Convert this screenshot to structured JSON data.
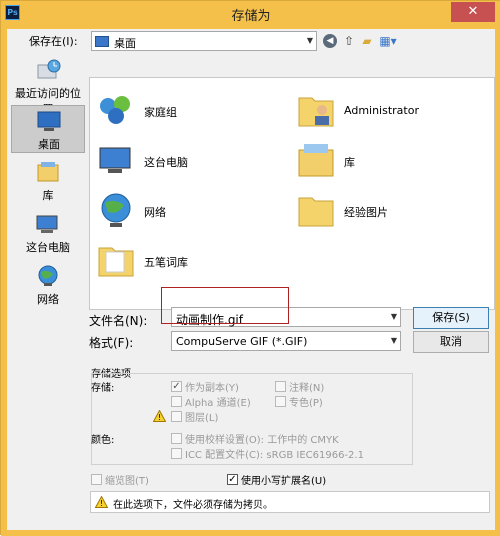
{
  "window": {
    "title": "存储为",
    "close": "✕",
    "app_icon": "Ps"
  },
  "save_in": {
    "label": "保存在(I):",
    "value": "桌面"
  },
  "places": [
    {
      "label": "最近访问的位置"
    },
    {
      "label": "桌面"
    },
    {
      "label": "库"
    },
    {
      "label": "这台电脑"
    },
    {
      "label": "网络"
    }
  ],
  "files": [
    {
      "name": "家庭组"
    },
    {
      "name": "Administrator"
    },
    {
      "name": "这台电脑"
    },
    {
      "name": "库"
    },
    {
      "name": "网络"
    },
    {
      "name": "经验图片"
    },
    {
      "name": "五笔词库"
    }
  ],
  "filename": {
    "label": "文件名(N):",
    "value": "动画制作.gif"
  },
  "format": {
    "label": "格式(F):",
    "value": "CompuServe GIF (*.GIF)"
  },
  "buttons": {
    "save": "保存(S)",
    "cancel": "取消"
  },
  "options": {
    "title": "存储选项",
    "save_label": "存储:",
    "as_copy": "作为副本(Y)",
    "notes": "注释(N)",
    "alpha": "Alpha 通道(E)",
    "spot": "专色(P)",
    "layers": "图层(L)",
    "color_label": "颜色:",
    "proof": "使用校样设置(O): 工作中的 CMYK",
    "icc": "ICC 配置文件(C): sRGB IEC61966-2.1"
  },
  "thumbnail": "缩览图(T)",
  "lowercase_ext": "使用小写扩展名(U)",
  "message": "在此选项下，文件必须存储为拷贝。",
  "colors": {
    "titlebar": "#f4c04a",
    "highlight": "#b02020"
  }
}
